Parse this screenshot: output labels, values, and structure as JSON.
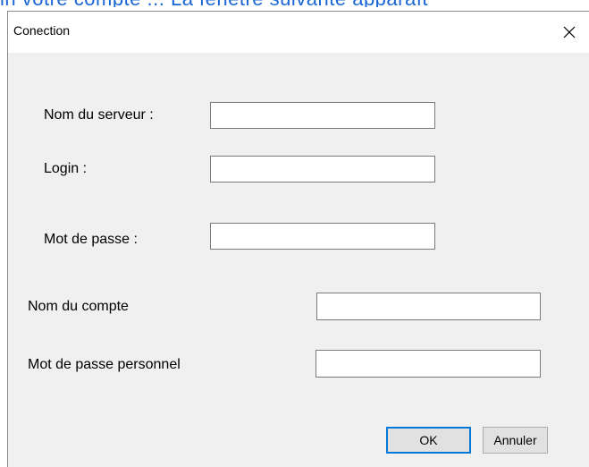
{
  "background_caption": "in votre compte ... La fenêtre suivante apparaît",
  "window": {
    "title": "Conection",
    "close_icon": "close-icon"
  },
  "form": {
    "server_name": {
      "label": "Nom du serveur :",
      "value": ""
    },
    "login": {
      "label": "Login :",
      "value": ""
    },
    "password": {
      "label": "Mot de passe :",
      "value": ""
    },
    "account_name": {
      "label": "Nom du compte",
      "value": ""
    },
    "personal_password": {
      "label": "Mot de passe personnel",
      "value": ""
    }
  },
  "buttons": {
    "ok_label": "OK",
    "cancel_label": "Annuler"
  },
  "colors": {
    "accent": "#0078d7",
    "dialog_bg": "#f0f0f0",
    "caption_blue": "#1a66d6"
  }
}
